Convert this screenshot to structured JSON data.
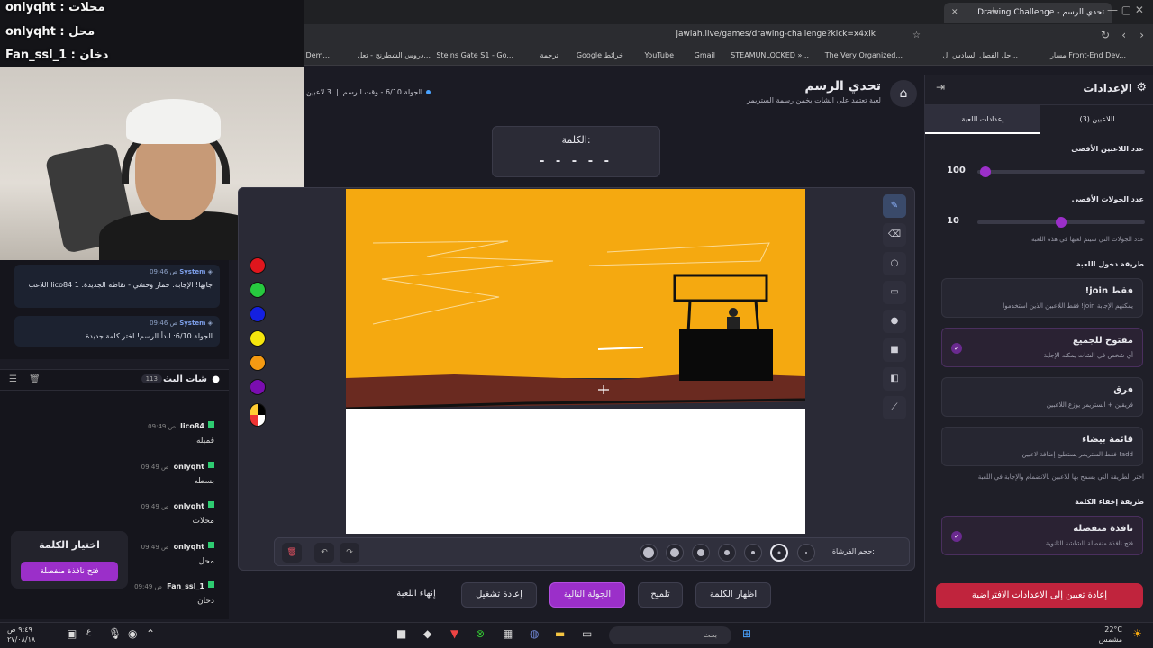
{
  "browser": {
    "tab_title": "Drawing Challenge - تحدي الرسم",
    "url": "jawlah.live/games/drawing-challenge?kick=x4xik",
    "bookmarks": [
      "مسار Front-End Dev...",
      "حل الفصل السادس ال...",
      "The Very Organized...",
      "STEAMUNLOCKED »...",
      "Gmail",
      "YouTube",
      "Google خرائط",
      "ترجمة",
      "Steins Gate S1 - Go...",
      "دروس الشطرنج - تعل...",
      "Quick Trading Dem..."
    ]
  },
  "overlay": {
    "line1": "onlyqht : محلات",
    "line2": "onlyqht : محل",
    "line3": "Fan_ssl_1 : دخان"
  },
  "system_chat": [
    {
      "user": "System",
      "time": "09:46 ص",
      "text": "اللاعب lico84 جابها! الإجابة: حمار وحشي - نقاطه الجديدة: 1"
    },
    {
      "user": "System",
      "time": "09:46 ص",
      "text": "الجولة 6/10: ابدأ الرسم! اختر كلمة جديدة"
    }
  ],
  "chat": {
    "title": "شات البث",
    "count": "113",
    "messages": [
      {
        "user": "lico84",
        "time": "09:49 ص",
        "text": "قمبله"
      },
      {
        "user": "onlyqht",
        "time": "09:49 ص",
        "text": "بسطه"
      },
      {
        "user": "onlyqht",
        "time": "09:49 ص",
        "text": "محلات"
      },
      {
        "user": "onlyqht",
        "time": "09:49 ص",
        "text": "محل"
      },
      {
        "user": "Fan_ssl_1",
        "time": "09:49 ص",
        "text": "دخان"
      }
    ]
  },
  "word_pick": {
    "title": "اختيار الكلمة",
    "button": "فتح نافذة منفصلة"
  },
  "game": {
    "title": "تحدي الرسم",
    "subtitle": "لعبة تعتمد على الشات يخمن رسمة الستريمر",
    "info": "الجولة 6/10 - وقت الرسم",
    "players": "3 لاعبين",
    "word_label": "الكلمة:",
    "word_mask": "- - - - -",
    "brush_label": "حجم الفرشاة:",
    "colors": [
      "#e0161d",
      "#27c93f",
      "#1420e0",
      "#f5e50d",
      "#f59a12",
      "#7a0db0"
    ]
  },
  "actions": {
    "reveal": "اظهار الكلمة",
    "hint": "تلميح",
    "next": "الجولة التالية",
    "restart": "إعادة تشغيل",
    "end": "إنهاء اللعبة"
  },
  "settings": {
    "title": "الإعدادات",
    "tab_players": "اللاعبين (3)",
    "tab_game": "إعدادات اللعبة",
    "max_players_label": "عدد اللاعبين الأقصى",
    "max_players": "100",
    "max_players_level": 0.02,
    "max_rounds_label": "عدد الجولات الأقصى",
    "max_rounds": "10",
    "max_rounds_level": 0.5,
    "rounds_hint": "عدد الجولات التي سيتم لعبها في هذه اللعبة",
    "entry_label": "طريقة دخول اللعبة",
    "entry_options": [
      {
        "title": "!join فقط",
        "desc": "فقط اللاعبين الذين استخدموا !join يمكنهم الإجابة"
      },
      {
        "title": "مفتوح للجميع",
        "desc": "أي شخص في الشات يمكنه الإجابة"
      },
      {
        "title": "فرق",
        "desc": "فريقين + الستريمر يوزع اللاعبين"
      },
      {
        "title": "قائمة بيضاء",
        "desc": "فقط الستريمر يستطيع إضافة لاعبين !add"
      }
    ],
    "entry_hint": "اختر الطريقة التي يسمح بها للاعبين بالانضمام والإجابة في اللعبة",
    "hide_label": "طريقة إخفاء الكلمة",
    "hide_option": {
      "title": "نافذة منفصلة",
      "desc": "فتح نافذة منفصلة للشاشة الثانوية"
    },
    "reset": "إعادة تعيين إلى الاعدادات الافتراضية"
  },
  "taskbar": {
    "search": "بحث",
    "temp": "22°C",
    "weather": "مشمس",
    "time": "٩:٤٩ ص",
    "date": "٢٧/٠٨/١٨"
  }
}
